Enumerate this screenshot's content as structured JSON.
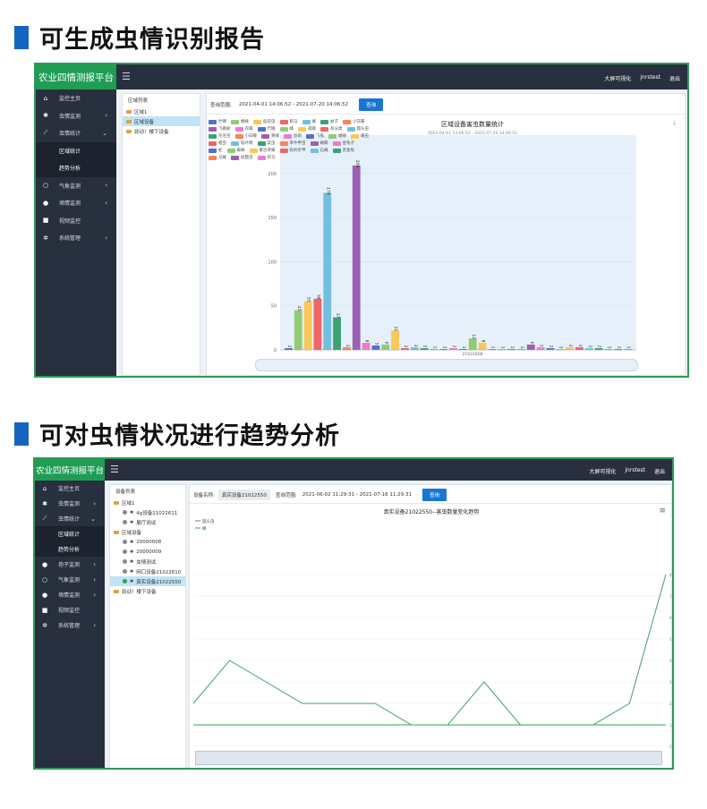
{
  "section1": {
    "title": "可生成虫情识别报告"
  },
  "section2": {
    "title": "可对虫情状况进行趋势分析"
  },
  "app": {
    "brand": "农业四情测报平台",
    "top_links": [
      "大屏可视化",
      "jnrstest",
      "退出"
    ]
  },
  "shot1": {
    "nav": [
      {
        "label": "监控主页",
        "icon": "home-icon",
        "chevron": ""
      },
      {
        "label": "虫情监测",
        "icon": "bug-icon",
        "chevron": "›"
      },
      {
        "label": "虫情统计",
        "icon": "chart-icon",
        "chevron": "⌄"
      },
      {
        "label": "区域统计",
        "icon": "",
        "chevron": "",
        "sub": true
      },
      {
        "label": "趋势分析",
        "icon": "",
        "chevron": "",
        "sub": true
      },
      {
        "label": "气象监测",
        "icon": "circle-icon",
        "chevron": "›"
      },
      {
        "label": "墒情监测",
        "icon": "globe-icon",
        "chevron": "›"
      },
      {
        "label": "视频监控",
        "icon": "camera-icon",
        "chevron": ""
      },
      {
        "label": "系统管理",
        "icon": "gear-icon",
        "chevron": "›"
      }
    ],
    "tree": {
      "title": "区域列表",
      "items": [
        "区域1",
        "区域设备",
        "劲动！楼下设备"
      ]
    },
    "query_label": "查询范围:",
    "query_value": "2021-04-01 14:06:52 - 2021-07-20 14:06:52",
    "query_button": "查询",
    "legend": [
      {
        "name": "叶蝉",
        "color": "#5470c6"
      },
      {
        "name": "蟋蟀",
        "color": "#91cc75"
      },
      {
        "name": "稻苞虫",
        "color": "#fac858"
      },
      {
        "name": "蓟马",
        "color": "#ee6666"
      },
      {
        "name": "蜂",
        "color": "#73c0de"
      },
      {
        "name": "蚊子",
        "color": "#3ba272"
      },
      {
        "name": "小灰蝶",
        "color": "#fc8452"
      },
      {
        "name": "飞蛾蚁",
        "color": "#9a60b4"
      },
      {
        "name": "衣蛾",
        "color": "#ea7ccc"
      },
      {
        "name": "尺蛾",
        "color": "#5470c6"
      },
      {
        "name": "蜂",
        "color": "#91cc75"
      },
      {
        "name": "夜蛾",
        "color": "#fac858"
      },
      {
        "name": "有分类",
        "color": "#ee6666"
      },
      {
        "name": "瓢头虫",
        "color": "#73c0de"
      },
      {
        "name": "毛毛虫",
        "color": "#3ba272"
      },
      {
        "name": "小白蝶",
        "color": "#fc8452"
      },
      {
        "name": "黄蜂",
        "color": "#9a60b4"
      },
      {
        "name": "蔗螟",
        "color": "#ea7ccc"
      },
      {
        "name": "飞虱",
        "color": "#5470c6"
      },
      {
        "name": "蟋蟀",
        "color": "#91cc75"
      },
      {
        "name": "蝽虫",
        "color": "#fac858"
      },
      {
        "name": "蝗虫",
        "color": "#ee6666"
      },
      {
        "name": "稻叶螟",
        "color": "#73c0de"
      },
      {
        "name": "菜虫",
        "color": "#3ba272"
      },
      {
        "name": "草牛甲虫",
        "color": "#fc8452"
      },
      {
        "name": "蝴蝶",
        "color": "#9a60b4"
      },
      {
        "name": "金龟子",
        "color": "#ea7ccc"
      },
      {
        "name": "虻",
        "color": "#5470c6"
      },
      {
        "name": "蜘蛛",
        "color": "#91cc75"
      },
      {
        "name": "蒙古草蜂",
        "color": "#fac858"
      },
      {
        "name": "蛇蛉步甲",
        "color": "#ee6666"
      },
      {
        "name": "石蝇",
        "color": "#73c0de"
      },
      {
        "name": "黑金龟",
        "color": "#3ba272"
      },
      {
        "name": "马蝇",
        "color": "#fc8452"
      },
      {
        "name": "斑蝥虫",
        "color": "#9a60b4"
      },
      {
        "name": "虾马",
        "color": "#ea7ccc"
      }
    ]
  },
  "shot2": {
    "nav": [
      {
        "label": "监控主页",
        "icon": "home-icon",
        "chevron": ""
      },
      {
        "label": "虫情监测",
        "icon": "bug-icon",
        "chevron": "›"
      },
      {
        "label": "虫情统计",
        "icon": "chart-icon",
        "chevron": "⌄"
      },
      {
        "label": "区域统计",
        "icon": "",
        "chevron": "",
        "sub": true
      },
      {
        "label": "趋势分析",
        "icon": "",
        "chevron": "",
        "sub": true
      },
      {
        "label": "孢子监测",
        "icon": "globe-icon",
        "chevron": "›"
      },
      {
        "label": "气象监测",
        "icon": "circle-icon",
        "chevron": "›"
      },
      {
        "label": "墒情监测",
        "icon": "globe-icon",
        "chevron": "›"
      },
      {
        "label": "视频监控",
        "icon": "camera-icon",
        "chevron": ""
      },
      {
        "label": "系统管理",
        "icon": "gear-icon",
        "chevron": "›"
      }
    ],
    "tree": {
      "title": "设备列表",
      "items": [
        {
          "label": "区域1",
          "kind": "folder"
        },
        {
          "label": "4g设备21022611",
          "kind": "device"
        },
        {
          "label": "展厅测试",
          "kind": "device"
        },
        {
          "label": "区域设备",
          "kind": "folder"
        },
        {
          "label": "20000008",
          "kind": "device"
        },
        {
          "label": "20000009",
          "kind": "device"
        },
        {
          "label": "虫情测试",
          "kind": "device"
        },
        {
          "label": "网口设备21022610",
          "kind": "device"
        },
        {
          "label": "真实设备21022550",
          "kind": "device-active"
        },
        {
          "label": "劲动！楼下设备",
          "kind": "folder"
        }
      ]
    },
    "device_label": "设备名称:",
    "device_value": "真实设备21022550",
    "query_label": "查询范围:",
    "query_value": "2021-06-02 11:29:31 - 2021-07-16 11:29:31",
    "query_button": "查询",
    "menu_icon": "≡"
  },
  "chart_data": [
    {
      "type": "bar",
      "title": "区域设备害虫数量统计",
      "subtitle": "2021-04-01 14:06:52 - 2021-07-20 14:06:52",
      "xlabel": "21022608",
      "y_ticks": [
        "0",
        "50",
        "100",
        "150",
        "200"
      ],
      "ylim": [
        0,
        215
      ],
      "grid": true,
      "legend_position": "top-left",
      "bar_labels": [
        "2\n蚜\n虫",
        "45\n稻\n苞\n虫",
        "55\n菜\n青\n虫",
        "58\n黄\n蜂",
        "178\n蜂",
        "37\n蚊子",
        "3\n小\n灰\n蝶",
        "209\n飞\n蛾\n蚁",
        "8\n衣\n蛾",
        "5\n尺\n蛾",
        "6\n蜂",
        "22\n夜\n蛾",
        "2\n未\n分\n类",
        "3\n瓢\n头\n虫",
        "2\n毛\n毛\n虫",
        "1\n小\n白\n蝶",
        "1\n黄\n蜂",
        "2\n蔗\n螟",
        "1\n飞\n虱",
        "13\n蟋\n蟀",
        "8\n蝽\n虫",
        "1\n蝗\n虫",
        "1\n稻\n叶\n螟",
        "1\n菜\n虫",
        "1\n草\n牛\n甲\n虫",
        "6\n蝴\n蝶",
        "3\n金\n龟\n子",
        "2\n虻",
        "1\n蜘\n蛛",
        "3\n蒙\n古\n草\n蜂",
        "3\n蛇\n蛉\n步\n甲",
        "2\n石\n蝇",
        "2\n黑\n金\n龟",
        "1\n马\n蝇",
        "1\n斑\n蝥\n虫",
        "1\n虾\n马"
      ],
      "values": [
        2,
        45,
        55,
        58,
        178,
        37,
        3,
        209,
        8,
        5,
        6,
        22,
        2,
        3,
        2,
        1,
        1,
        2,
        1,
        13,
        8,
        1,
        1,
        1,
        1,
        6,
        3,
        2,
        1,
        3,
        3,
        2,
        2,
        1,
        1,
        1
      ]
    },
    {
      "type": "line",
      "title": "真实设备21022550--害虫数量变化趋势",
      "y_ticks": [
        "0",
        "1",
        "2",
        "3",
        "4",
        "5",
        "6",
        "7",
        "8"
      ],
      "ylim": [
        0,
        8
      ],
      "series": [
        {
          "name": "瓢头虫",
          "color": "#3ba272",
          "values": [
            2,
            4,
            3,
            2,
            2,
            2,
            1,
            1,
            3,
            1,
            1,
            1,
            2,
            8
          ]
        },
        {
          "name": "蜂",
          "color": "#2fa84f",
          "values": [
            1,
            1,
            1,
            1,
            1,
            1,
            1,
            1,
            1,
            1,
            1,
            1,
            1,
            1
          ]
        }
      ]
    }
  ]
}
